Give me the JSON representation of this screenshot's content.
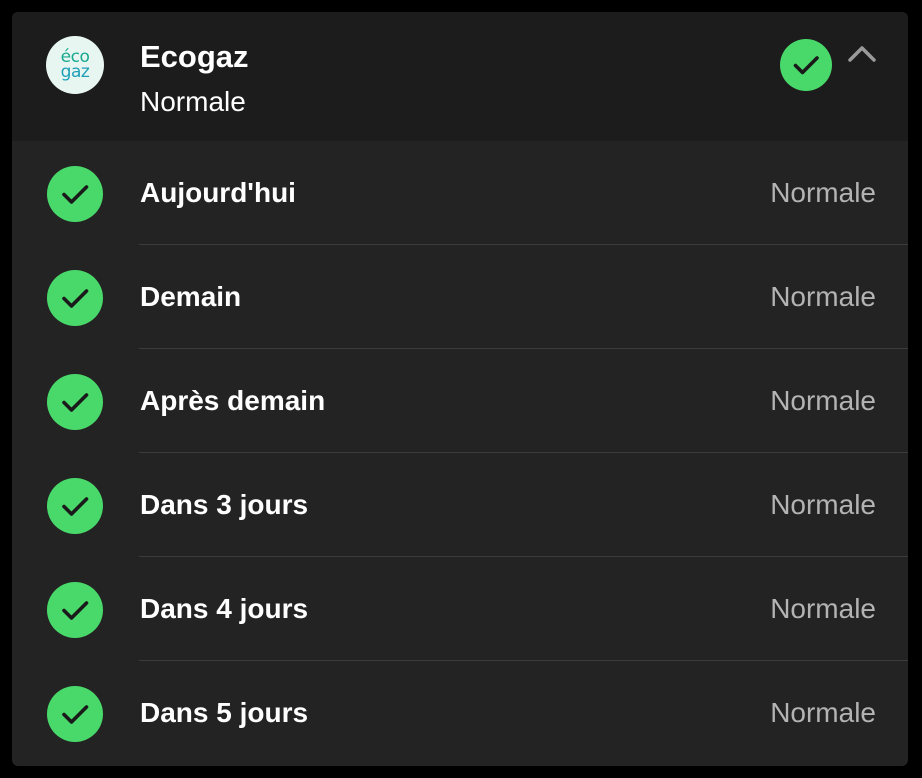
{
  "colors": {
    "status_ok": "#48d96a",
    "check_mark": "#1a1a1a",
    "header_bg": "#1c1c1c",
    "card_bg": "#232323",
    "muted_text": "#b3b3b3"
  },
  "header": {
    "logo": {
      "line1": "éco",
      "line2": "gaz",
      "icon": "ecogaz-logo"
    },
    "title": "Ecogaz",
    "subtitle": "Normale",
    "status_icon": "check-circle-icon",
    "collapse_icon": "chevron-up-icon"
  },
  "forecast": [
    {
      "label": "Aujourd'hui",
      "status": "Normale",
      "icon": "check-circle-icon"
    },
    {
      "label": "Demain",
      "status": "Normale",
      "icon": "check-circle-icon"
    },
    {
      "label": "Après demain",
      "status": "Normale",
      "icon": "check-circle-icon"
    },
    {
      "label": "Dans 3 jours",
      "status": "Normale",
      "icon": "check-circle-icon"
    },
    {
      "label": "Dans 4 jours",
      "status": "Normale",
      "icon": "check-circle-icon"
    },
    {
      "label": "Dans 5 jours",
      "status": "Normale",
      "icon": "check-circle-icon"
    }
  ]
}
